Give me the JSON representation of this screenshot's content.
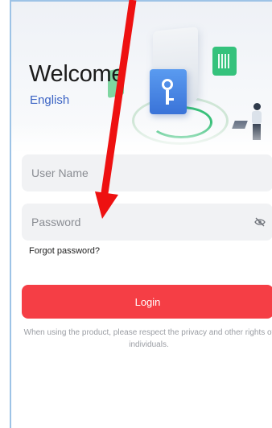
{
  "header": {
    "welcome": "Welcome",
    "language": "English"
  },
  "form": {
    "username_placeholder": "User Name",
    "password_placeholder": "Password",
    "forgot_password": "Forgot password?",
    "login_label": "Login"
  },
  "footer": {
    "notice": "When using the product, please respect the privacy and other rights of individuals."
  },
  "icons": {
    "password_toggle": "eye-slash-icon",
    "hero_key": "key-icon",
    "hero_audio": "audio-bars-icon",
    "annotation": "red-arrow-icon"
  },
  "colors": {
    "accent": "#f53e45",
    "link": "#3b63c4",
    "field_bg": "#f1f2f4",
    "frame_border": "#9dc3e6",
    "annotation": "#ee1111"
  }
}
